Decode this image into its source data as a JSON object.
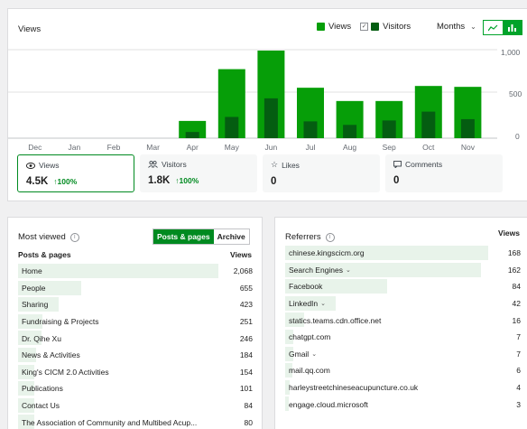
{
  "views_card": {
    "title": "Views",
    "legend": [
      {
        "label": "Views",
        "color": "#069e08"
      },
      {
        "label": "Visitors",
        "color": "#045d11",
        "checked": true
      }
    ],
    "period": "Months",
    "y_ticks": [
      "1,000",
      "500",
      "0"
    ]
  },
  "chart_data": {
    "type": "bar",
    "categories": [
      "Dec",
      "Jan",
      "Feb",
      "Mar",
      "Apr",
      "May",
      "Jun",
      "Jul",
      "Aug",
      "Sep",
      "Oct",
      "Nov"
    ],
    "series": [
      {
        "name": "Views",
        "values": [
          0,
          0,
          0,
          0,
          195,
          780,
          990,
          570,
          420,
          420,
          590,
          580
        ]
      },
      {
        "name": "Visitors",
        "values": [
          0,
          0,
          0,
          0,
          70,
          240,
          450,
          190,
          150,
          200,
          300,
          215
        ]
      }
    ],
    "ylim": [
      0,
      1000
    ],
    "grid": true
  },
  "stats": [
    {
      "label": "Views",
      "icon": "eye-icon",
      "value": "4.5K",
      "change": "↑100%"
    },
    {
      "label": "Visitors",
      "icon": "people-icon",
      "value": "1.8K",
      "change": "↑100%"
    },
    {
      "label": "Likes",
      "icon": "star-icon",
      "value": "0",
      "change": ""
    },
    {
      "label": "Comments",
      "icon": "comment-icon",
      "value": "0",
      "change": ""
    }
  ],
  "most_viewed": {
    "title": "Most viewed",
    "tabs": [
      "Posts & pages",
      "Archive"
    ],
    "col_left": "Posts & pages",
    "col_right": "Views",
    "rows": [
      {
        "name": "Home",
        "value": "2,068",
        "num": 2068
      },
      {
        "name": "People",
        "value": "655",
        "num": 655
      },
      {
        "name": "Sharing",
        "value": "423",
        "num": 423
      },
      {
        "name": "Fundraising & Projects",
        "value": "251",
        "num": 251
      },
      {
        "name": "Dr. Qihe Xu",
        "value": "246",
        "num": 246
      },
      {
        "name": "News & Activities",
        "value": "184",
        "num": 184
      },
      {
        "name": "King's CICM 2.0 Activities",
        "value": "154",
        "num": 154
      },
      {
        "name": "Publications",
        "value": "101",
        "num": 101
      },
      {
        "name": "Contact Us",
        "value": "84",
        "num": 84
      },
      {
        "name": "The Association of Community and Multibed Acup...",
        "value": "80",
        "num": 80
      }
    ]
  },
  "referrers": {
    "title": "Referrers",
    "col_right": "Views",
    "rows": [
      {
        "name": "chinese.kingscicm.org",
        "value": "168",
        "num": 168,
        "expand": false
      },
      {
        "name": "Search Engines",
        "value": "162",
        "num": 162,
        "expand": true
      },
      {
        "name": "Facebook",
        "value": "84",
        "num": 84,
        "expand": false
      },
      {
        "name": "LinkedIn",
        "value": "42",
        "num": 42,
        "expand": true
      },
      {
        "name": "statics.teams.cdn.office.net",
        "value": "16",
        "num": 16,
        "expand": false
      },
      {
        "name": "chatgpt.com",
        "value": "7",
        "num": 7,
        "expand": false
      },
      {
        "name": "Gmail",
        "value": "7",
        "num": 7,
        "expand": true
      },
      {
        "name": "mail.qq.com",
        "value": "6",
        "num": 6,
        "expand": false
      },
      {
        "name": "harleystreetchineseacupuncture.co.uk",
        "value": "4",
        "num": 4,
        "expand": false
      },
      {
        "name": "engage.cloud.microsoft",
        "value": "3",
        "num": 3,
        "expand": false
      }
    ]
  }
}
